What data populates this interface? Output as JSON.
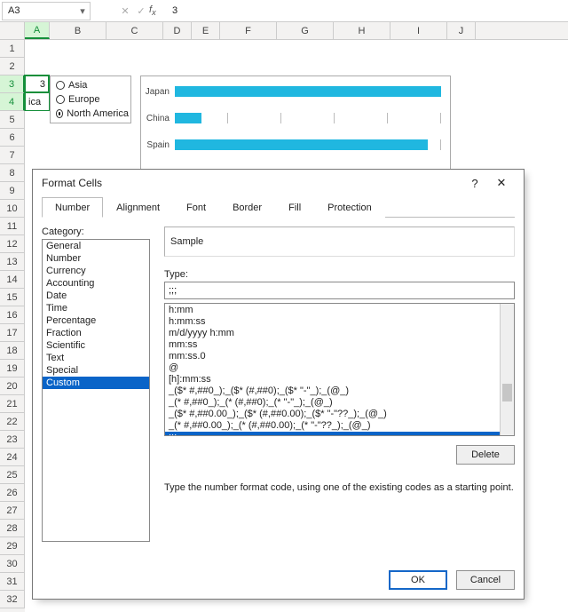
{
  "name_box": "A3",
  "formula_bar_value": "3",
  "columns": [
    {
      "id": "A",
      "w": 28,
      "sel": true
    },
    {
      "id": "B",
      "w": 64
    },
    {
      "id": "C",
      "w": 64
    },
    {
      "id": "D",
      "w": 32
    },
    {
      "id": "E",
      "w": 32
    },
    {
      "id": "F",
      "w": 64
    },
    {
      "id": "G",
      "w": 64
    },
    {
      "id": "H",
      "w": 64
    },
    {
      "id": "I",
      "w": 64
    },
    {
      "id": "J",
      "w": 32
    }
  ],
  "row_count": 32,
  "selected_rows": [
    3,
    4
  ],
  "cells": {
    "A3": "3",
    "A4": "ica"
  },
  "radio_options": [
    {
      "label": "Asia",
      "checked": false
    },
    {
      "label": "Europe",
      "checked": false
    },
    {
      "label": "North America",
      "checked": true
    }
  ],
  "chart_data": {
    "type": "bar",
    "categories": [
      "Japan",
      "China",
      "Spain"
    ],
    "values": [
      100,
      10,
      95
    ],
    "title": "",
    "xlabel": "",
    "ylabel": "",
    "ylim": [
      0,
      100
    ]
  },
  "dialog": {
    "title": "Format Cells",
    "tabs": [
      "Number",
      "Alignment",
      "Font",
      "Border",
      "Fill",
      "Protection"
    ],
    "active_tab": "Number",
    "category_label": "Category:",
    "categories": [
      "General",
      "Number",
      "Currency",
      "Accounting",
      "Date",
      "Time",
      "Percentage",
      "Fraction",
      "Scientific",
      "Text",
      "Special",
      "Custom"
    ],
    "selected_category": "Custom",
    "sample_label": "Sample",
    "sample_value": "",
    "type_label": "Type:",
    "type_value": ";;;",
    "type_list": [
      "h:mm",
      "h:mm:ss",
      "m/d/yyyy h:mm",
      "mm:ss",
      "mm:ss.0",
      "@",
      "[h]:mm:ss",
      "_($* #,##0_);_($* (#,##0);_($* \"-\"_);_(@_)",
      "_(* #,##0_);_(* (#,##0);_(* \"-\"_);_(@_)",
      "_($* #,##0.00_);_($* (#,##0.00);_($* \"-\"??_);_(@_)",
      "_(* #,##0.00_);_(* (#,##0.00);_(* \"-\"??_);_(@_)",
      ";;;",
      ""
    ],
    "hint": "Type the number format code, using one of the existing codes as a starting point.",
    "btn_delete": "Delete",
    "btn_ok": "OK",
    "btn_cancel": "Cancel"
  }
}
